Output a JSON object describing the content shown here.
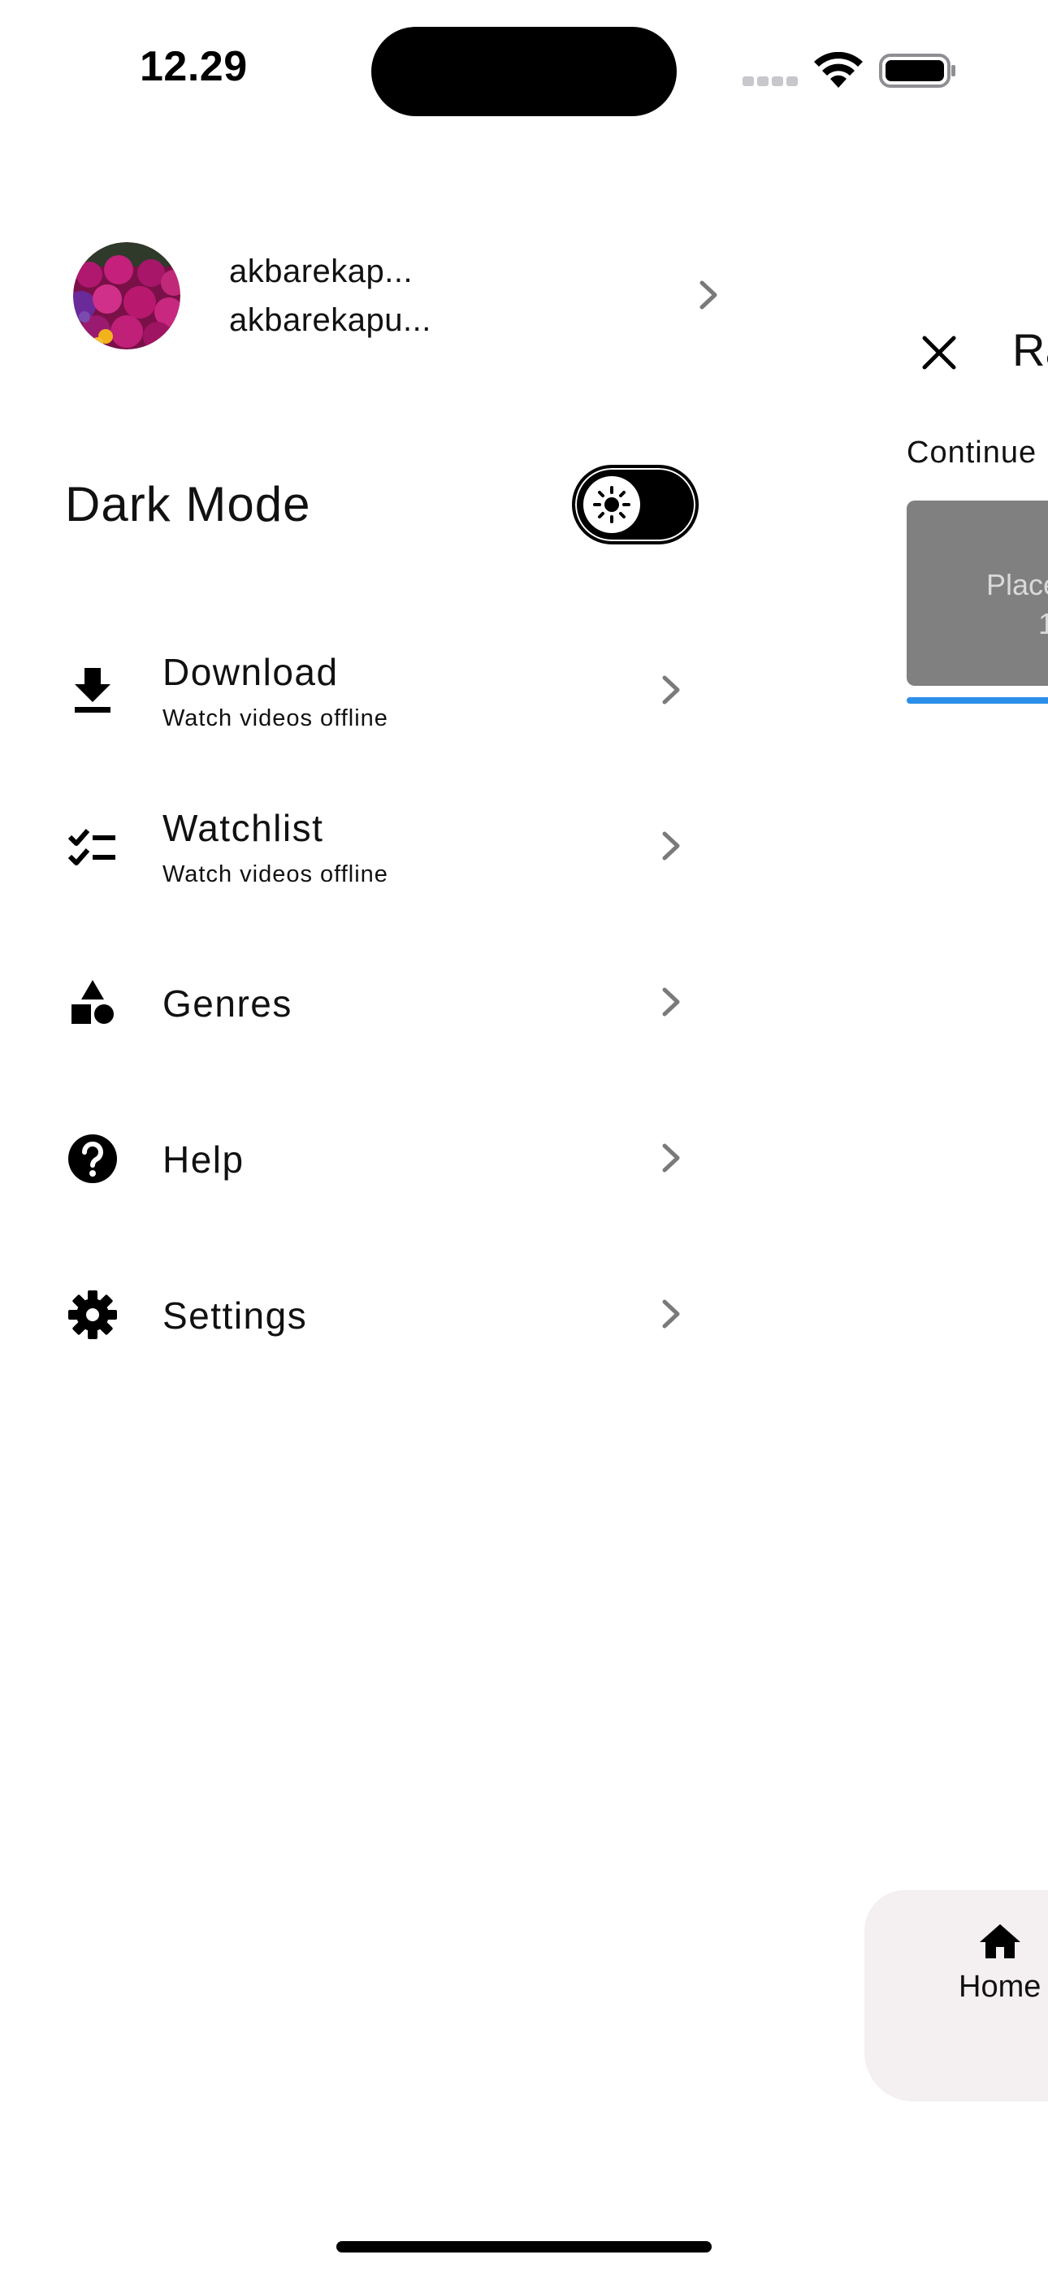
{
  "status_bar": {
    "time": "12.29"
  },
  "profile": {
    "name": "akbarekap...",
    "email": "akbarekapu..."
  },
  "dark_mode": {
    "label": "Dark Mode",
    "enabled": false
  },
  "menu": [
    {
      "title": "Download",
      "subtitle": "Watch videos offline",
      "icon": "download-icon"
    },
    {
      "title": "Watchlist",
      "subtitle": "Watch videos offline",
      "icon": "checklist-icon"
    },
    {
      "title": "Genres",
      "subtitle": "",
      "icon": "category-shapes-icon"
    },
    {
      "title": "Help",
      "subtitle": "",
      "icon": "help-icon"
    },
    {
      "title": "Settings",
      "subtitle": "",
      "icon": "gear-icon"
    }
  ],
  "background_screen": {
    "title_fragment": "Ra",
    "section_label": "Continue",
    "card_text_line1": "Place",
    "card_text_line2": "1",
    "nav_home_label": "Home"
  },
  "colors": {
    "accent_progress": "#2b8fe8",
    "card_placeholder": "#808080",
    "bottom_nav_bg": "#f4eff1"
  }
}
